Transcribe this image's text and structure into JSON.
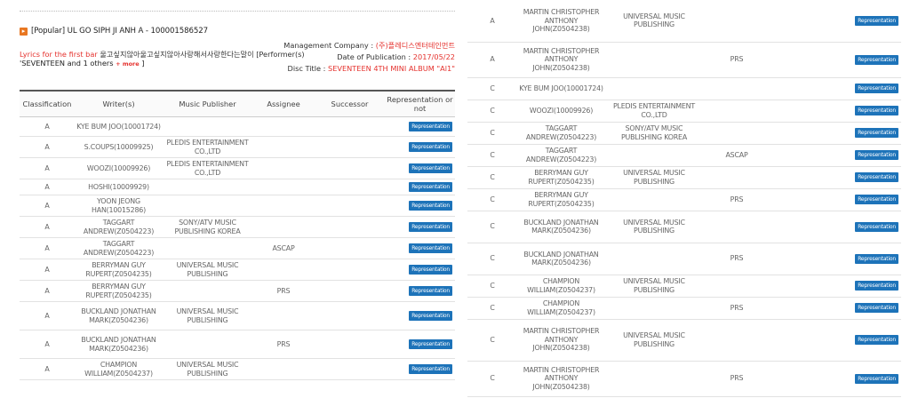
{
  "header": {
    "title": "[Popular] UL GO SIPH JI ANH A - 100001586527",
    "lyrics_label": "Lyrics for the first bar",
    "lyrics_text": "울고싶지않아울고싶지않아사랑해서사랑한다는말이 [Performer(s)",
    "performer_text": "'SEVENTEEN and 1 others",
    "more_label": "+ more",
    "close_bracket": "]",
    "mgmt_label": "Management Company :",
    "mgmt_value": "(주)플레디스엔터테인먼트",
    "pub_label": "Date of Publication :",
    "pub_value": "2017/05/22",
    "disc_label": "Disc Title :",
    "disc_value": "SEVENTEEN 4TH MINI ALBUM \"Al1\""
  },
  "table": {
    "columns": [
      "Classification",
      "Writer(s)",
      "Music Publisher",
      "Assignee",
      "Successor",
      "Representation or not"
    ]
  },
  "left_rows": [
    {
      "c": "A",
      "w": "KYE BUM JOO(10001724)",
      "p": "",
      "a": "",
      "s": "",
      "b": "Representation",
      "h": 22
    },
    {
      "c": "A",
      "w": "S.COUPS(10009925)",
      "p": "PLEDIS ENTERTAINMENT CO.,LTD",
      "a": "",
      "s": "",
      "b": "Representation",
      "h": 24
    },
    {
      "c": "A",
      "w": "WOOZI(10009926)",
      "p": "PLEDIS ENTERTAINMENT CO.,LTD",
      "a": "",
      "s": "",
      "b": "Representation",
      "h": 24
    },
    {
      "c": "A",
      "w": "HOSHI(10009929)",
      "p": "",
      "a": "",
      "s": "",
      "b": "Representation",
      "h": 18
    },
    {
      "c": "A",
      "w": "YOON JEONG HAN(10015286)",
      "p": "",
      "a": "",
      "s": "",
      "b": "Representation",
      "h": 24
    },
    {
      "c": "A",
      "w": "TAGGART ANDREW(Z0504223)",
      "p": "SONY/ATV MUSIC PUBLISHING KOREA",
      "a": "",
      "s": "",
      "b": "Representation",
      "h": 24
    },
    {
      "c": "A",
      "w": "TAGGART ANDREW(Z0504223)",
      "p": "",
      "a": "ASCAP",
      "s": "",
      "b": "Representation",
      "h": 24
    },
    {
      "c": "A",
      "w": "BERRYMAN GUY RUPERT(Z0504235)",
      "p": "UNIVERSAL MUSIC PUBLISHING",
      "a": "",
      "s": "",
      "b": "Representation",
      "h": 24
    },
    {
      "c": "A",
      "w": "BERRYMAN GUY RUPERT(Z0504235)",
      "p": "",
      "a": "PRS",
      "s": "",
      "b": "Representation",
      "h": 24
    },
    {
      "c": "A",
      "w": "BUCKLAND JONATHAN MARK(Z0504236)",
      "p": "UNIVERSAL MUSIC PUBLISHING",
      "a": "",
      "s": "",
      "b": "Representation",
      "h": 32
    },
    {
      "c": "A",
      "w": "BUCKLAND JONATHAN MARK(Z0504236)",
      "p": "",
      "a": "PRS",
      "s": "",
      "b": "Representation",
      "h": 32
    },
    {
      "c": "A",
      "w": "CHAMPION WILLIAM(Z0504237)",
      "p": "UNIVERSAL MUSIC PUBLISHING",
      "a": "",
      "s": "",
      "b": "Representation",
      "h": 24
    }
  ],
  "right_rows": [
    {
      "c": "A",
      "w": "MARTIN CHRISTOPHER ANTHONY JOHN(Z0504238)",
      "p": "UNIVERSAL MUSIC PUBLISHING",
      "a": "",
      "s": "",
      "b": "Representation",
      "h": 47
    },
    {
      "c": "A",
      "w": "MARTIN CHRISTOPHER ANTHONY JOHN(Z0504238)",
      "p": "",
      "a": "PRS",
      "s": "",
      "b": "Representation",
      "h": 40
    },
    {
      "c": "C",
      "w": "KYE BUM JOO(10001724)",
      "p": "",
      "a": "",
      "s": "",
      "b": "Representation",
      "h": 25
    },
    {
      "c": "C",
      "w": "WOOZI(10009926)",
      "p": "PLEDIS ENTERTAINMENT CO.,LTD",
      "a": "",
      "s": "",
      "b": "Representation",
      "h": 25
    },
    {
      "c": "C",
      "w": "TAGGART ANDREW(Z0504223)",
      "p": "SONY/ATV MUSIC PUBLISHING KOREA",
      "a": "",
      "s": "",
      "b": "Representation",
      "h": 25
    },
    {
      "c": "C",
      "w": "TAGGART ANDREW(Z0504223)",
      "p": "",
      "a": "ASCAP",
      "s": "",
      "b": "Representation",
      "h": 25
    },
    {
      "c": "C",
      "w": "BERRYMAN GUY RUPERT(Z0504235)",
      "p": "UNIVERSAL MUSIC PUBLISHING",
      "a": "",
      "s": "",
      "b": "Representation",
      "h": 25
    },
    {
      "c": "C",
      "w": "BERRYMAN GUY RUPERT(Z0504235)",
      "p": "",
      "a": "PRS",
      "s": "",
      "b": "Representation",
      "h": 25
    },
    {
      "c": "C",
      "w": "BUCKLAND JONATHAN MARK(Z0504236)",
      "p": "UNIVERSAL MUSIC PUBLISHING",
      "a": "",
      "s": "",
      "b": "Representation",
      "h": 36
    },
    {
      "c": "C",
      "w": "BUCKLAND JONATHAN MARK(Z0504236)",
      "p": "",
      "a": "PRS",
      "s": "",
      "b": "Representation",
      "h": 36
    },
    {
      "c": "C",
      "w": "CHAMPION WILLIAM(Z0504237)",
      "p": "UNIVERSAL MUSIC PUBLISHING",
      "a": "",
      "s": "",
      "b": "Representation",
      "h": 25
    },
    {
      "c": "C",
      "w": "CHAMPION WILLIAM(Z0504237)",
      "p": "",
      "a": "PRS",
      "s": "",
      "b": "Representation",
      "h": 25
    },
    {
      "c": "C",
      "w": "MARTIN CHRISTOPHER ANTHONY JOHN(Z0504238)",
      "p": "UNIVERSAL MUSIC PUBLISHING",
      "a": "",
      "s": "",
      "b": "Representation",
      "h": 47
    },
    {
      "c": "C",
      "w": "MARTIN CHRISTOPHER ANTHONY JOHN(Z0504238)",
      "p": "",
      "a": "PRS",
      "s": "",
      "b": "Representation",
      "h": 40
    }
  ]
}
